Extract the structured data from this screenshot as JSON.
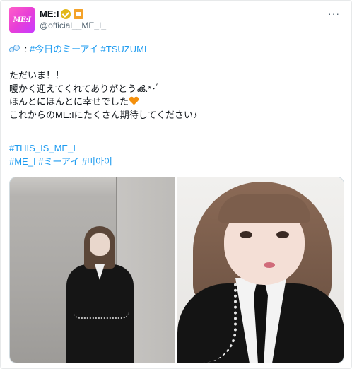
{
  "post": {
    "author": {
      "avatar_text": "ME:I",
      "display_name": "ME:I",
      "handle": "@official__ME_I_",
      "badges": [
        "verified-gold-icon",
        "affiliate-badge-icon"
      ]
    },
    "more_menu_label": "···",
    "lines": [
      {
        "emoji": "bubbles-icon",
        "prefix": " : ",
        "hashtags": [
          "#今日のミーアイ",
          "#TSUZUMI"
        ]
      },
      {
        "text": "ただいま！！"
      },
      {
        "text": "暖かく迎えてくれてありがとうൿ.*･ﾟ"
      },
      {
        "text": "ほんとにほんとに幸せでした",
        "emoji": "orange-heart-icon"
      },
      {
        "text": "これからのME:Iにたくさん期待してください♪"
      }
    ],
    "hashtag_block_1": [
      "#THIS_IS_ME_I"
    ],
    "hashtag_block_2": [
      "#ME_I",
      "#ミーアイ",
      "#미아이"
    ]
  },
  "colors": {
    "link": "#1d9bf0",
    "text": "#0f1419",
    "muted": "#536471",
    "avatar_pink": "#e83fd6",
    "verified_gold": "#e2b719",
    "heart_orange": "#f4900c"
  },
  "media": [
    {
      "name": "photo-left"
    },
    {
      "name": "photo-right"
    }
  ]
}
